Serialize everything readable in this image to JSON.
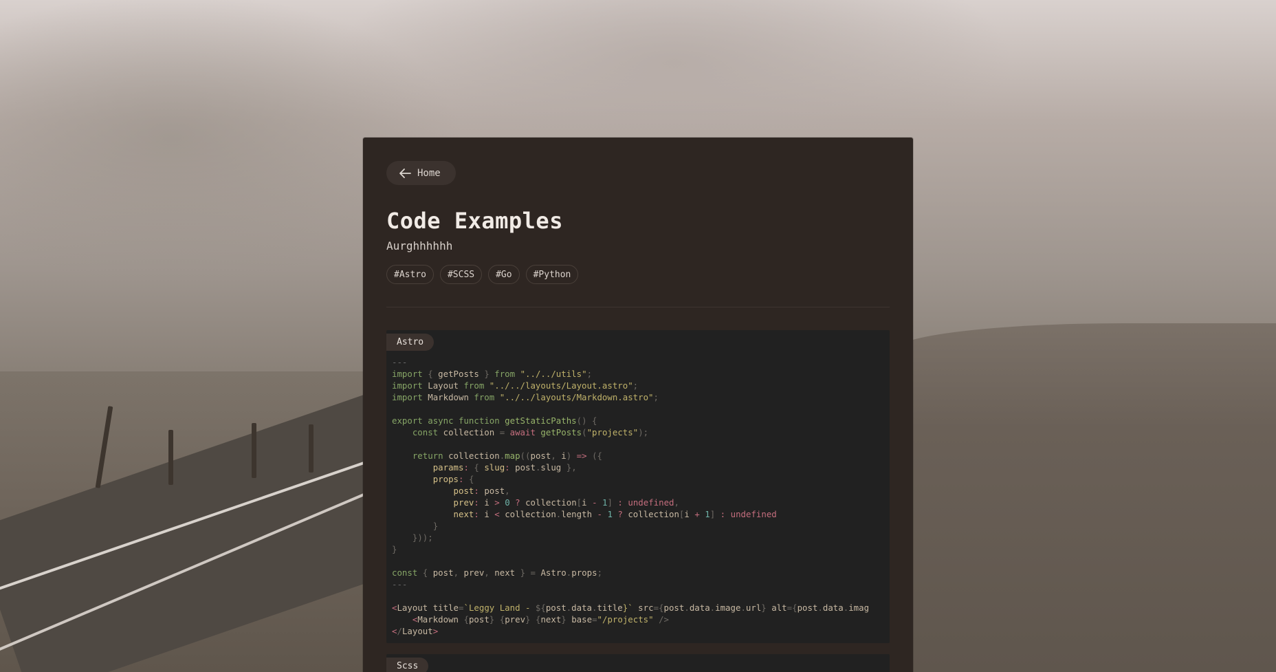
{
  "nav": {
    "home_label": "Home"
  },
  "page": {
    "title": "Code Examples",
    "subtitle": "Aurghhhhhh"
  },
  "tags": [
    "#Astro",
    "#SCSS",
    "#Go",
    "#Python"
  ],
  "code_blocks": [
    {
      "language": "Astro",
      "lines": [
        "---",
        "import { getPosts } from \"../../utils\";",
        "import Layout from \"../../layouts/Layout.astro\";",
        "import Markdown from \"../../layouts/Markdown.astro\";",
        "",
        "export async function getStaticPaths() {",
        "    const collection = await getPosts(\"projects\");",
        "",
        "    return collection.map((post, i) => ({",
        "        params: { slug: post.slug },",
        "        props: {",
        "            post: post,",
        "            prev: i > 0 ? collection[i - 1] : undefined,",
        "            next: i < collection.length - 1 ? collection[i + 1] : undefined",
        "        }",
        "    }));",
        "}",
        "",
        "const { post, prev, next } = Astro.props;",
        "---",
        "",
        "<Layout title=`Leggy Land - ${post.data.title}` src={post.data.image.url} alt={post.data.imag",
        "    <Markdown {post} {prev} {next} base=\"/projects\" />",
        "</Layout>"
      ]
    },
    {
      "language": "Scss",
      "lines": []
    }
  ],
  "colors": {
    "card_bg": "#2e2622",
    "code_bg": "#212121",
    "accent_keyword": "#86a566",
    "accent_operator": "#c56e7e",
    "accent_string": "#c0b26a"
  },
  "icons": {
    "home": "arrow-left-icon"
  }
}
